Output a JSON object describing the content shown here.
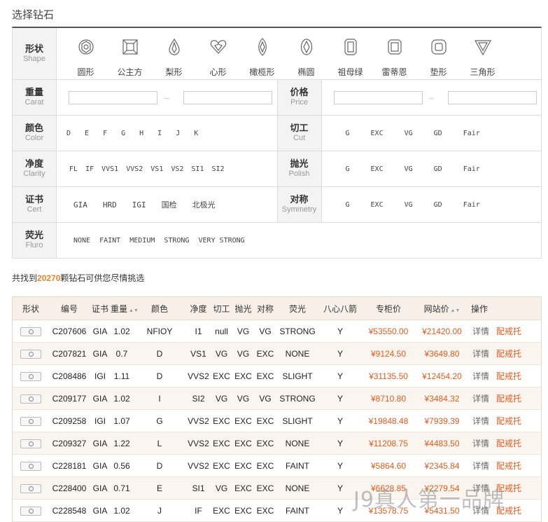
{
  "page_title": "选择钻石",
  "filters": {
    "shape": {
      "cn": "形状",
      "en": "Shape",
      "items": [
        {
          "name": "圆形",
          "icon": "round-diamond-icon"
        },
        {
          "name": "公主方",
          "icon": "princess-diamond-icon"
        },
        {
          "name": "梨形",
          "icon": "pear-diamond-icon"
        },
        {
          "name": "心形",
          "icon": "heart-diamond-icon"
        },
        {
          "name": "橄榄形",
          "icon": "marquise-diamond-icon"
        },
        {
          "name": "椭圆",
          "icon": "oval-diamond-icon"
        },
        {
          "name": "祖母绿",
          "icon": "emerald-diamond-icon"
        },
        {
          "name": "雷蒂恩",
          "icon": "radiant-diamond-icon"
        },
        {
          "name": "垫形",
          "icon": "cushion-diamond-icon"
        },
        {
          "name": "三角形",
          "icon": "trillion-diamond-icon"
        }
      ]
    },
    "carat": {
      "cn": "重量",
      "en": "Carat",
      "sep": "—"
    },
    "price": {
      "cn": "价格",
      "en": "Price",
      "sep": "—"
    },
    "color": {
      "cn": "颜色",
      "en": "Color",
      "options": [
        "D",
        "E",
        "F",
        "G",
        "H",
        "I",
        "J",
        "K"
      ]
    },
    "cut": {
      "cn": "切工",
      "en": "Cut",
      "options": [
        "G",
        "EXC",
        "VG",
        "GD",
        "Fair"
      ]
    },
    "clarity": {
      "cn": "净度",
      "en": "Clarity",
      "options": [
        "FL",
        "IF",
        "VVS1",
        "VVS2",
        "VS1",
        "VS2",
        "SI1",
        "SI2"
      ]
    },
    "polish": {
      "cn": "抛光",
      "en": "Polish",
      "options": [
        "G",
        "EXC",
        "VG",
        "GD",
        "Fair"
      ]
    },
    "cert": {
      "cn": "证书",
      "en": "Cert",
      "options": [
        "GIA",
        "HRD",
        "IGI",
        "国检",
        "北极光"
      ]
    },
    "symmetry": {
      "cn": "对称",
      "en": "Symmetry",
      "options": [
        "G",
        "EXC",
        "VG",
        "GD",
        "Fair"
      ]
    },
    "fluro": {
      "cn": "荧光",
      "en": "Fluro",
      "options": [
        "NONE",
        "FAINT",
        "MEDIUM",
        "STRONG",
        "VERY STRONG"
      ]
    }
  },
  "found": {
    "prefix": "共找到",
    "count": "20270",
    "suffix": "颗钻石可供您尽情挑选"
  },
  "table": {
    "headers": [
      "形状",
      "编号",
      "证书",
      "重量",
      "颜色",
      "净度",
      "切工",
      "抛光",
      "对称",
      "荧光",
      "八心八箭",
      "专柜价",
      "网站价",
      "操作"
    ],
    "detail_label": "详情",
    "match_label": "配戒托",
    "rows": [
      {
        "id": "C207606",
        "cert": "GIA",
        "carat": "1.02",
        "color": "NFIOY",
        "clarity": "I1",
        "cut": "null",
        "polish": "VG",
        "sym": "VG",
        "fluro": "STRONG",
        "hearts": "Y",
        "counter": "¥53550.00",
        "web": "¥21420.00",
        "shape": "pear"
      },
      {
        "id": "C207821",
        "cert": "GIA",
        "carat": "0.7",
        "color": "D",
        "clarity": "VS1",
        "cut": "VG",
        "polish": "VG",
        "sym": "EXC",
        "fluro": "NONE",
        "hearts": "Y",
        "counter": "¥9124.50",
        "web": "¥3649.80",
        "shape": "round"
      },
      {
        "id": "C208486",
        "cert": "IGI",
        "carat": "1.11",
        "color": "D",
        "clarity": "VVS2",
        "cut": "EXC",
        "polish": "EXC",
        "sym": "EXC",
        "fluro": "SLIGHT",
        "hearts": "Y",
        "counter": "¥31135.50",
        "web": "¥12454.20",
        "shape": "round"
      },
      {
        "id": "C209177",
        "cert": "GIA",
        "carat": "1.02",
        "color": "I",
        "clarity": "SI2",
        "cut": "VG",
        "polish": "VG",
        "sym": "VG",
        "fluro": "STRONG",
        "hearts": "Y",
        "counter": "¥8710.80",
        "web": "¥3484.32",
        "shape": "round"
      },
      {
        "id": "C209258",
        "cert": "IGI",
        "carat": "1.07",
        "color": "G",
        "clarity": "VVS2",
        "cut": "EXC",
        "polish": "EXC",
        "sym": "EXC",
        "fluro": "SLIGHT",
        "hearts": "Y",
        "counter": "¥19848.48",
        "web": "¥7939.39",
        "shape": "round"
      },
      {
        "id": "C209327",
        "cert": "GIA",
        "carat": "1.22",
        "color": "L",
        "clarity": "VVS2",
        "cut": "EXC",
        "polish": "EXC",
        "sym": "EXC",
        "fluro": "NONE",
        "hearts": "Y",
        "counter": "¥11208.75",
        "web": "¥4483.50",
        "shape": "round"
      },
      {
        "id": "C228181",
        "cert": "GIA",
        "carat": "0.56",
        "color": "D",
        "clarity": "VVS2",
        "cut": "EXC",
        "polish": "EXC",
        "sym": "EXC",
        "fluro": "FAINT",
        "hearts": "Y",
        "counter": "¥5864.60",
        "web": "¥2345.84",
        "shape": "round"
      },
      {
        "id": "C228400",
        "cert": "GIA",
        "carat": "0.71",
        "color": "E",
        "clarity": "SI1",
        "cut": "VG",
        "polish": "EXC",
        "sym": "EXC",
        "fluro": "NONE",
        "hearts": "Y",
        "counter": "¥6628.85",
        "web": "¥2279.54",
        "shape": "round"
      },
      {
        "id": "C228548",
        "cert": "GIA",
        "carat": "1.02",
        "color": "J",
        "clarity": "IF",
        "cut": "EXC",
        "polish": "EXC",
        "sym": "EXC",
        "fluro": "FAINT",
        "hearts": "Y",
        "counter": "¥13578.75",
        "web": "¥5431.50",
        "shape": "round"
      }
    ]
  },
  "watermark": "J9真人第一品牌",
  "accent": "#e85a1c"
}
